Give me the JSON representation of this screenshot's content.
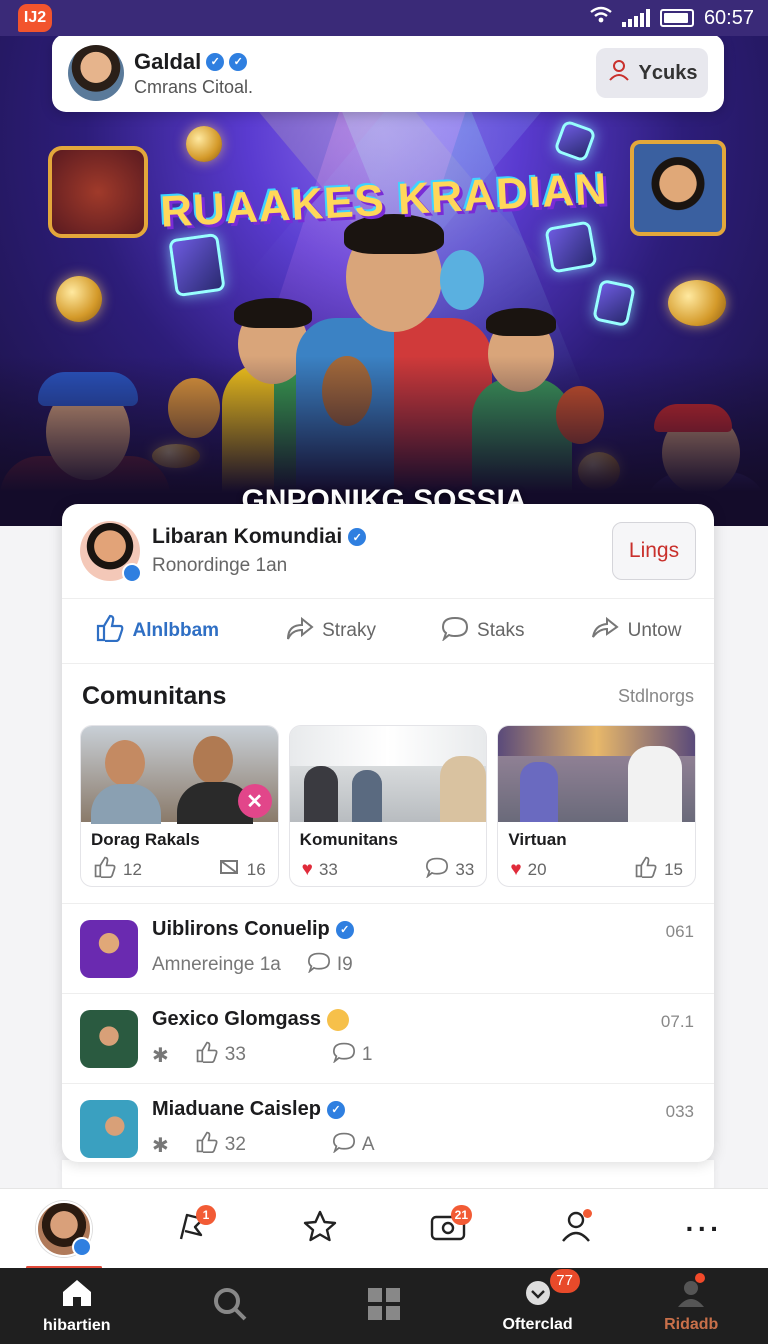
{
  "status_bar": {
    "notification_count": "IJ2",
    "time": "60:57"
  },
  "header": {
    "name": "Galdal",
    "subtitle": "Cmrans Citoal.",
    "button_label": "Ycuks"
  },
  "hero": {
    "title": "RUAAKES KRADIAN",
    "subtitle": "GNPONIKG SOSSIA"
  },
  "post": {
    "title": "Libaran Komundiai",
    "subtitle": "Ronordinge 1an",
    "action_button": "Lings",
    "actions": [
      {
        "label": "Alnlbbam",
        "icon": "thumbs-up-icon"
      },
      {
        "label": "Straky",
        "icon": "share-icon"
      },
      {
        "label": "Staks",
        "icon": "comment-icon"
      },
      {
        "label": "Untow",
        "icon": "share-alt-icon"
      }
    ]
  },
  "communities": {
    "title": "Comunitans",
    "link": "Stdlnorgs",
    "tiles": [
      {
        "label": "Dorag Rakals",
        "stat1": "12",
        "stat2": "16"
      },
      {
        "label": "Komunitans",
        "stat1": "33",
        "stat2": "33"
      },
      {
        "label": "Virtuan",
        "stat1": "20",
        "stat2": "15"
      }
    ]
  },
  "feed": [
    {
      "title": "Uiblirons Conuelip",
      "subtitle": "Amnereinge 1a",
      "comments": "I9",
      "time": "061"
    },
    {
      "title": "Gexico Glomgass",
      "likes": "33",
      "comments": "1",
      "time": "07.1"
    },
    {
      "title": "Miaduane Caislep",
      "likes": "32",
      "comments": "A",
      "time": "033"
    }
  ],
  "action_bar": {
    "notif_count_1": "1",
    "notif_count_2": "21"
  },
  "nav": {
    "home_label": "hibartien",
    "messages_label": "Ofterclad",
    "messages_badge": "77",
    "profile_label": "Ridadb"
  },
  "colors": {
    "accent": "#2f6fc4",
    "brand": "#3a2a78",
    "alert": "#f25b35"
  }
}
